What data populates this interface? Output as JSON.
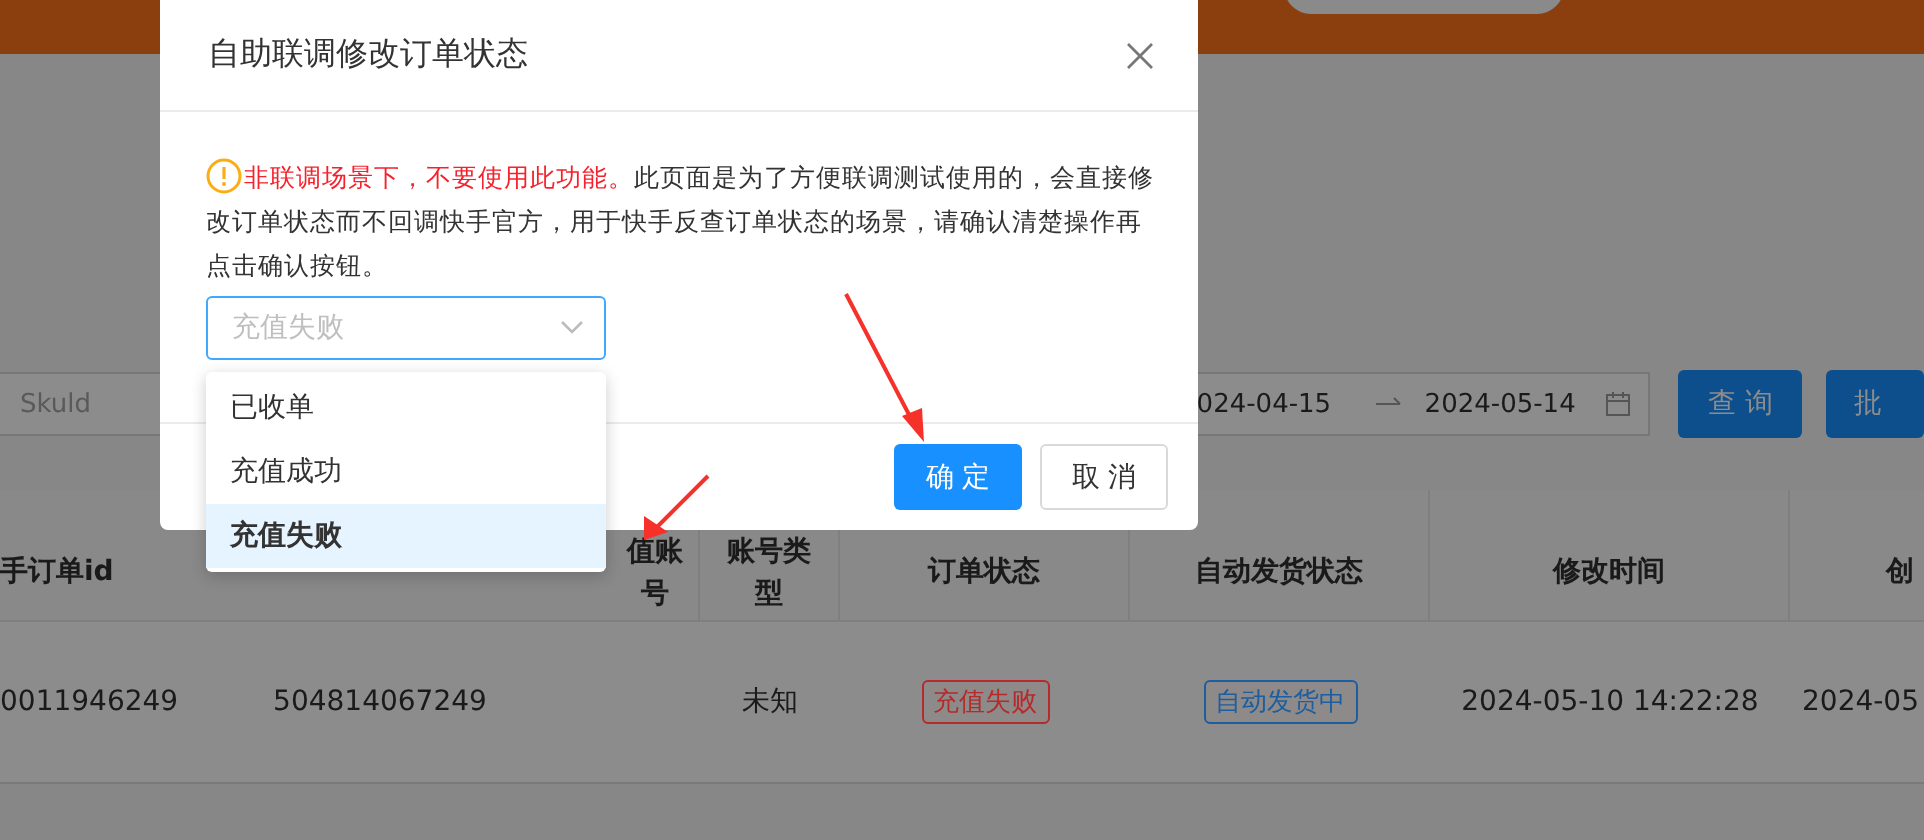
{
  "filters": {
    "sku_placeholder": "Skuld",
    "date_start": "024-04-15",
    "date_end": "2024-05-14",
    "buttons": [
      "查 询",
      "批"
    ]
  },
  "table": {
    "columns": [
      "手订单id",
      "",
      "值账号",
      "账号类型",
      "订单状态",
      "自动发货状态",
      "修改时间",
      "创"
    ],
    "rows": [
      {
        "cells": [
          {
            "kind": "text",
            "text": "0011946249"
          },
          {
            "kind": "text",
            "text": "504814067249"
          },
          {
            "kind": "blank"
          },
          {
            "kind": "text",
            "text": "未知"
          },
          {
            "kind": "tag",
            "text": "充值失败",
            "color": "#b52a2a"
          },
          {
            "kind": "tag",
            "text": "自动发货中",
            "color": "#1d5e9e"
          },
          {
            "kind": "text",
            "text": "2024-05-10 14:22:28"
          },
          {
            "kind": "text",
            "text": "2024-05"
          }
        ]
      }
    ]
  },
  "modal": {
    "title": "自助联调修改订单状态",
    "warning_bold": "非联调场景下，不要使用此功能。",
    "warning_text": "此页面是为了方便联调测试使用的，会直接修改订单状态而不回调快手官方，用于快手反查订单状态的场景，请确认清楚操作再点击确认按钮。",
    "select": {
      "value": "充值失败",
      "open": true
    },
    "options": [
      {
        "label": "已收单",
        "selected": false
      },
      {
        "label": "充值成功",
        "selected": false
      },
      {
        "label": "充值失败",
        "selected": true
      }
    ],
    "ok": "确 定",
    "cancel": "取 消"
  }
}
